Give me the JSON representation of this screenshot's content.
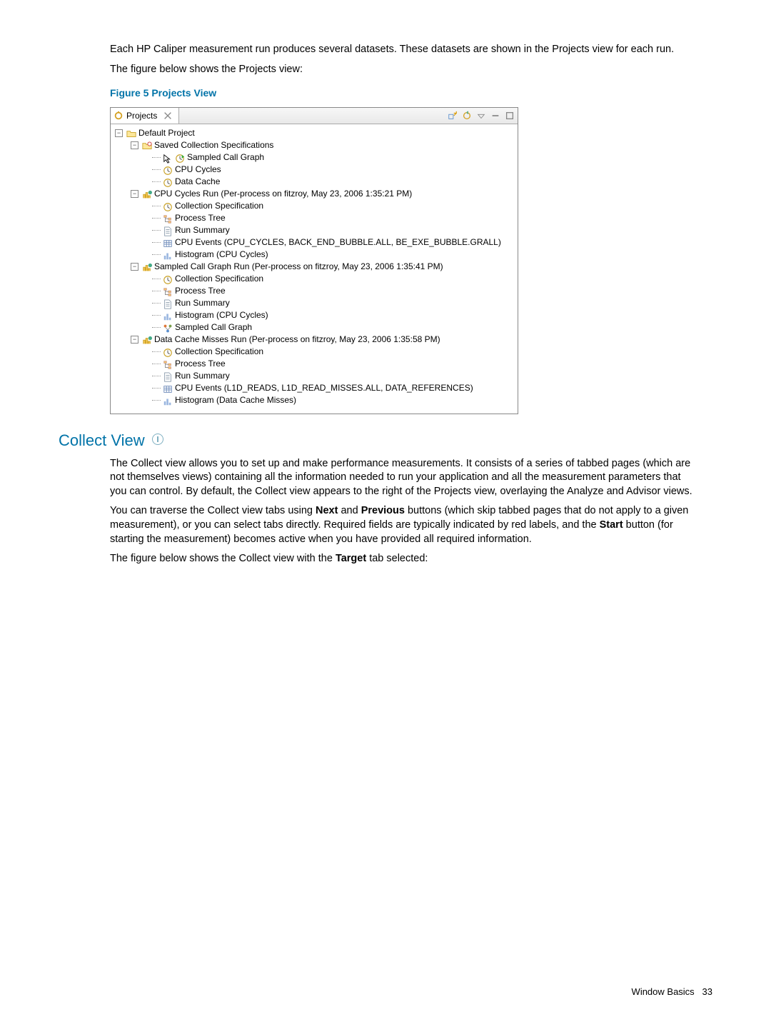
{
  "intro": {
    "p1": "Each HP Caliper measurement run produces several datasets. These datasets are shown in the Projects view for each run.",
    "p2": "The figure below shows the Projects view:"
  },
  "figure5_caption": "Figure 5 Projects View",
  "projects_panel": {
    "tab_label": "Projects",
    "root_label": "Default Project",
    "saved_spec_label": "Saved Collection Specifications",
    "saved_spec_items": [
      "Sampled Call Graph",
      "CPU Cycles",
      "Data Cache"
    ],
    "runs": [
      {
        "label": "CPU Cycles Run (Per-process on fitzroy, May 23, 2006 1:35:21 PM)",
        "children": [
          {
            "icon": "clock",
            "label": "Collection Specification"
          },
          {
            "icon": "ptree",
            "label": "Process Tree"
          },
          {
            "icon": "page",
            "label": "Run Summary"
          },
          {
            "icon": "table",
            "label": "CPU Events (CPU_CYCLES, BACK_END_BUBBLE.ALL, BE_EXE_BUBBLE.GRALL)"
          },
          {
            "icon": "histo",
            "label": "Histogram (CPU Cycles)"
          }
        ]
      },
      {
        "label": "Sampled Call Graph Run (Per-process on fitzroy, May 23, 2006 1:35:41 PM)",
        "children": [
          {
            "icon": "clock",
            "label": "Collection Specification"
          },
          {
            "icon": "ptree",
            "label": "Process Tree"
          },
          {
            "icon": "page",
            "label": "Run Summary"
          },
          {
            "icon": "histo",
            "label": "Histogram (CPU Cycles)"
          },
          {
            "icon": "callg",
            "label": "Sampled Call Graph"
          }
        ]
      },
      {
        "label": "Data Cache Misses Run (Per-process on fitzroy, May 23, 2006 1:35:58 PM)",
        "children": [
          {
            "icon": "clock",
            "label": "Collection Specification"
          },
          {
            "icon": "ptree",
            "label": "Process Tree"
          },
          {
            "icon": "page",
            "label": "Run Summary"
          },
          {
            "icon": "table",
            "label": "CPU Events (L1D_READS, L1D_READ_MISSES.ALL, DATA_REFERENCES)"
          },
          {
            "icon": "histo",
            "label": "Histogram (Data Cache Misses)"
          }
        ]
      }
    ]
  },
  "collect_view": {
    "heading": "Collect View",
    "p1": "The Collect view allows you to set up and make performance measurements. It consists of a series of tabbed pages (which are not themselves views) containing all the information needed to run your application and all the measurement parameters that you can control. By default, the Collect view appears to the right of the Projects view, overlaying the Analyze and Advisor views.",
    "p2a": "You can traverse the Collect view tabs using ",
    "p2_next": "Next",
    "p2b": " and ",
    "p2_prev": "Previous",
    "p2c": " buttons (which skip tabbed pages that do not apply to a given measurement), or you can select tabs directly. Required fields are typically indicated by red labels, and the ",
    "p2_start": "Start",
    "p2d": " button (for starting the measurement) becomes active when you have provided all required information.",
    "p3a": "The figure below shows the Collect view with the ",
    "p3_target": "Target",
    "p3b": " tab selected:"
  },
  "footer": {
    "section": "Window Basics",
    "page": "33"
  }
}
